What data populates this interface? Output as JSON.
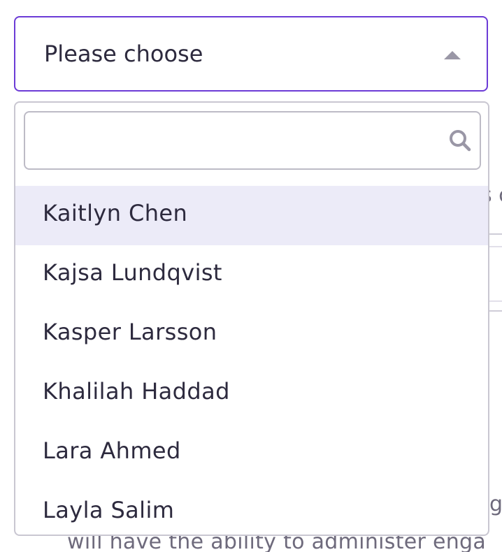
{
  "background": {
    "right_fragment": "s c",
    "mid_fragment": "gr",
    "bottom_fragment": "will have the ability to administer enga"
  },
  "select": {
    "placeholder": "Please choose",
    "caret_icon": "caret-up-icon",
    "accent_color": "#6c3bd6"
  },
  "dropdown": {
    "search": {
      "value": "",
      "placeholder": "",
      "icon": "search-icon"
    },
    "highlight_color": "#ecebf8",
    "options": [
      {
        "label": "Kaitlyn Chen",
        "highlighted": true
      },
      {
        "label": "Kajsa Lundqvist",
        "highlighted": false
      },
      {
        "label": "Kasper Larsson",
        "highlighted": false
      },
      {
        "label": "Khalilah Haddad",
        "highlighted": false
      },
      {
        "label": "Lara Ahmed",
        "highlighted": false
      },
      {
        "label": "Layla Salim",
        "highlighted": false
      }
    ]
  }
}
